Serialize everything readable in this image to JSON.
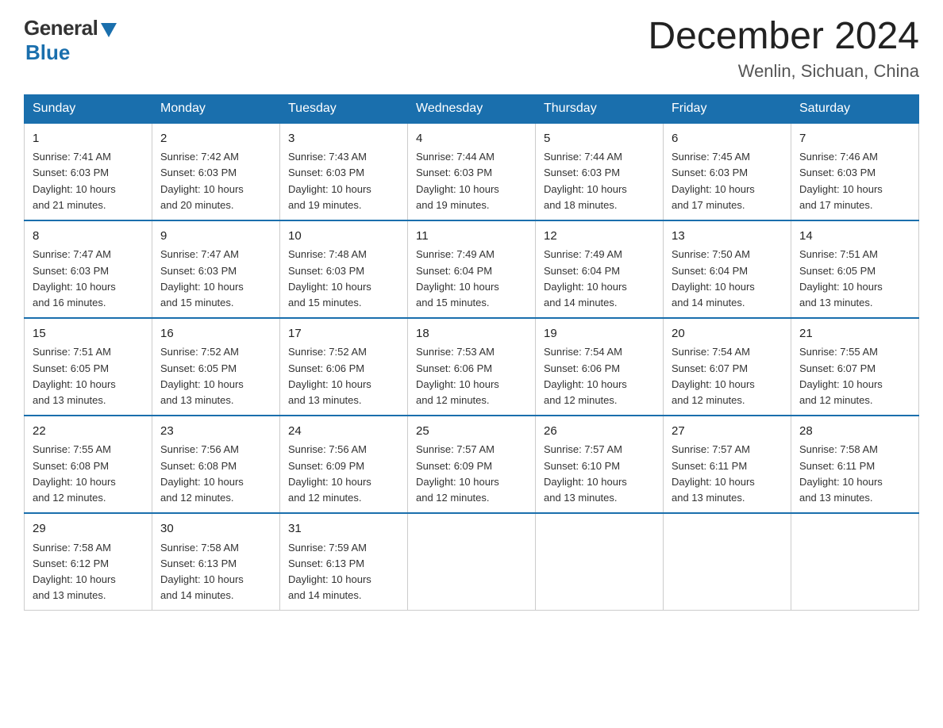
{
  "header": {
    "logo_general": "General",
    "logo_blue": "Blue",
    "month_title": "December 2024",
    "location": "Wenlin, Sichuan, China"
  },
  "weekdays": [
    "Sunday",
    "Monday",
    "Tuesday",
    "Wednesday",
    "Thursday",
    "Friday",
    "Saturday"
  ],
  "weeks": [
    [
      {
        "day": "1",
        "info": "Sunrise: 7:41 AM\nSunset: 6:03 PM\nDaylight: 10 hours\nand 21 minutes."
      },
      {
        "day": "2",
        "info": "Sunrise: 7:42 AM\nSunset: 6:03 PM\nDaylight: 10 hours\nand 20 minutes."
      },
      {
        "day": "3",
        "info": "Sunrise: 7:43 AM\nSunset: 6:03 PM\nDaylight: 10 hours\nand 19 minutes."
      },
      {
        "day": "4",
        "info": "Sunrise: 7:44 AM\nSunset: 6:03 PM\nDaylight: 10 hours\nand 19 minutes."
      },
      {
        "day": "5",
        "info": "Sunrise: 7:44 AM\nSunset: 6:03 PM\nDaylight: 10 hours\nand 18 minutes."
      },
      {
        "day": "6",
        "info": "Sunrise: 7:45 AM\nSunset: 6:03 PM\nDaylight: 10 hours\nand 17 minutes."
      },
      {
        "day": "7",
        "info": "Sunrise: 7:46 AM\nSunset: 6:03 PM\nDaylight: 10 hours\nand 17 minutes."
      }
    ],
    [
      {
        "day": "8",
        "info": "Sunrise: 7:47 AM\nSunset: 6:03 PM\nDaylight: 10 hours\nand 16 minutes."
      },
      {
        "day": "9",
        "info": "Sunrise: 7:47 AM\nSunset: 6:03 PM\nDaylight: 10 hours\nand 15 minutes."
      },
      {
        "day": "10",
        "info": "Sunrise: 7:48 AM\nSunset: 6:03 PM\nDaylight: 10 hours\nand 15 minutes."
      },
      {
        "day": "11",
        "info": "Sunrise: 7:49 AM\nSunset: 6:04 PM\nDaylight: 10 hours\nand 15 minutes."
      },
      {
        "day": "12",
        "info": "Sunrise: 7:49 AM\nSunset: 6:04 PM\nDaylight: 10 hours\nand 14 minutes."
      },
      {
        "day": "13",
        "info": "Sunrise: 7:50 AM\nSunset: 6:04 PM\nDaylight: 10 hours\nand 14 minutes."
      },
      {
        "day": "14",
        "info": "Sunrise: 7:51 AM\nSunset: 6:05 PM\nDaylight: 10 hours\nand 13 minutes."
      }
    ],
    [
      {
        "day": "15",
        "info": "Sunrise: 7:51 AM\nSunset: 6:05 PM\nDaylight: 10 hours\nand 13 minutes."
      },
      {
        "day": "16",
        "info": "Sunrise: 7:52 AM\nSunset: 6:05 PM\nDaylight: 10 hours\nand 13 minutes."
      },
      {
        "day": "17",
        "info": "Sunrise: 7:52 AM\nSunset: 6:06 PM\nDaylight: 10 hours\nand 13 minutes."
      },
      {
        "day": "18",
        "info": "Sunrise: 7:53 AM\nSunset: 6:06 PM\nDaylight: 10 hours\nand 12 minutes."
      },
      {
        "day": "19",
        "info": "Sunrise: 7:54 AM\nSunset: 6:06 PM\nDaylight: 10 hours\nand 12 minutes."
      },
      {
        "day": "20",
        "info": "Sunrise: 7:54 AM\nSunset: 6:07 PM\nDaylight: 10 hours\nand 12 minutes."
      },
      {
        "day": "21",
        "info": "Sunrise: 7:55 AM\nSunset: 6:07 PM\nDaylight: 10 hours\nand 12 minutes."
      }
    ],
    [
      {
        "day": "22",
        "info": "Sunrise: 7:55 AM\nSunset: 6:08 PM\nDaylight: 10 hours\nand 12 minutes."
      },
      {
        "day": "23",
        "info": "Sunrise: 7:56 AM\nSunset: 6:08 PM\nDaylight: 10 hours\nand 12 minutes."
      },
      {
        "day": "24",
        "info": "Sunrise: 7:56 AM\nSunset: 6:09 PM\nDaylight: 10 hours\nand 12 minutes."
      },
      {
        "day": "25",
        "info": "Sunrise: 7:57 AM\nSunset: 6:09 PM\nDaylight: 10 hours\nand 12 minutes."
      },
      {
        "day": "26",
        "info": "Sunrise: 7:57 AM\nSunset: 6:10 PM\nDaylight: 10 hours\nand 13 minutes."
      },
      {
        "day": "27",
        "info": "Sunrise: 7:57 AM\nSunset: 6:11 PM\nDaylight: 10 hours\nand 13 minutes."
      },
      {
        "day": "28",
        "info": "Sunrise: 7:58 AM\nSunset: 6:11 PM\nDaylight: 10 hours\nand 13 minutes."
      }
    ],
    [
      {
        "day": "29",
        "info": "Sunrise: 7:58 AM\nSunset: 6:12 PM\nDaylight: 10 hours\nand 13 minutes."
      },
      {
        "day": "30",
        "info": "Sunrise: 7:58 AM\nSunset: 6:13 PM\nDaylight: 10 hours\nand 14 minutes."
      },
      {
        "day": "31",
        "info": "Sunrise: 7:59 AM\nSunset: 6:13 PM\nDaylight: 10 hours\nand 14 minutes."
      },
      {
        "day": "",
        "info": ""
      },
      {
        "day": "",
        "info": ""
      },
      {
        "day": "",
        "info": ""
      },
      {
        "day": "",
        "info": ""
      }
    ]
  ]
}
